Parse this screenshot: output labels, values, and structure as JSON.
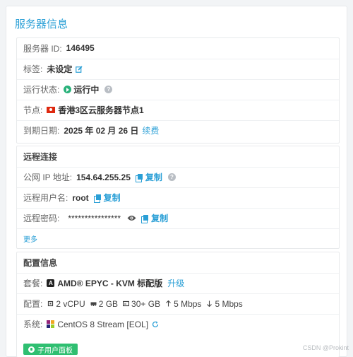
{
  "panel": {
    "title": "服务器信息"
  },
  "server": {
    "id_label": "服务器 ID:",
    "id_value": "146495",
    "tag_label": "标签:",
    "tag_value": "未设定",
    "status_label": "运行状态:",
    "status_value": "运行中",
    "node_label": "节点:",
    "node_value": "香港3区云服务器节点1",
    "expire_label": "到期日期:",
    "expire_value": "2025 年 02 月 26 日",
    "renew_link": "续费"
  },
  "remote": {
    "header": "远程连接",
    "ip_label": "公网 IP 地址:",
    "ip_value": "154.64.255.25",
    "copy_label": "复制",
    "user_label": "远程用户名:",
    "user_value": "root",
    "password_label": "远程密码:",
    "password_value": "****************",
    "more_link": "更多"
  },
  "config": {
    "header": "配置信息",
    "plan_label": "套餐:",
    "plan_value": "AMD® EPYC - KVM 标配版",
    "upgrade_link": "升级",
    "spec_label": "配置:",
    "cpu": "2 vCPU",
    "ram": "2 GB",
    "disk": "30+ GB",
    "up": "5 Mbps",
    "down": "5 Mbps",
    "os_label": "系统:",
    "os_value": "CentOS 8 Stream [EOL]",
    "panel_button": "子用户面板"
  },
  "watermark": "CSDN @Prokint",
  "colors": {
    "accent": "#2a9fd6",
    "status_green": "#2ab27b",
    "button_green": "#2fbf71"
  }
}
